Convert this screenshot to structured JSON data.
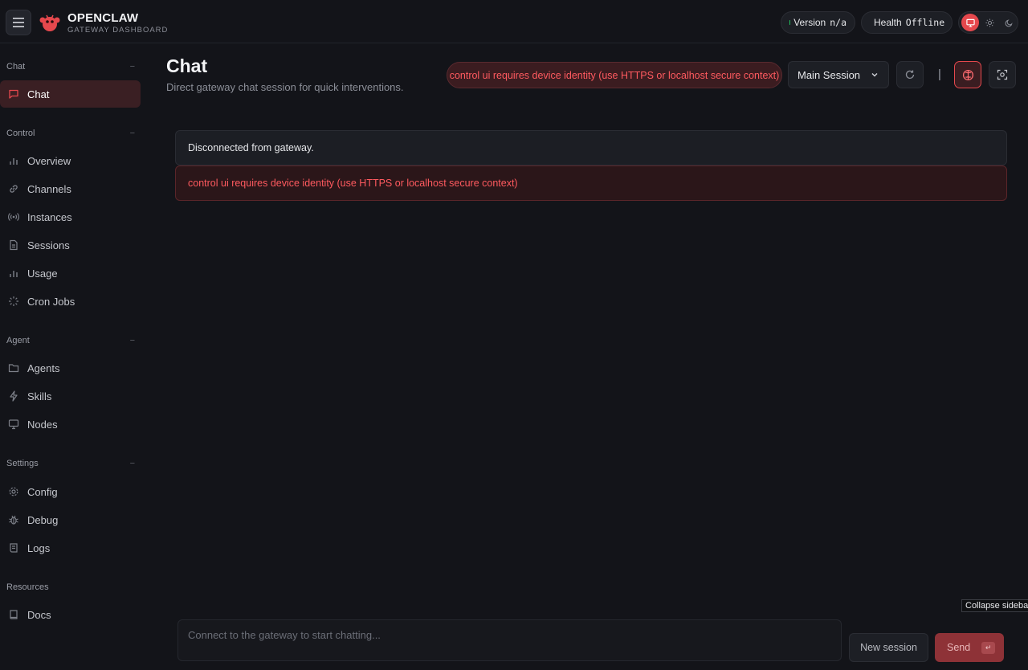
{
  "brand": {
    "title": "OPENCLAW",
    "subtitle": "GATEWAY DASHBOARD"
  },
  "status": {
    "version_label": "Version",
    "version_value": "n/a",
    "version_color": "#22c55e",
    "health_label": "Health",
    "health_value": "Offline",
    "health_color": "#ef4444"
  },
  "sidebar": {
    "sections": [
      {
        "label": "Chat",
        "items": [
          {
            "label": "Chat",
            "icon": "message-icon",
            "active": true
          }
        ]
      },
      {
        "label": "Control",
        "items": [
          {
            "label": "Overview",
            "icon": "bar-chart-icon"
          },
          {
            "label": "Channels",
            "icon": "link-icon"
          },
          {
            "label": "Instances",
            "icon": "broadcast-icon"
          },
          {
            "label": "Sessions",
            "icon": "document-icon"
          },
          {
            "label": "Usage",
            "icon": "bar-chart-icon"
          },
          {
            "label": "Cron Jobs",
            "icon": "loader-icon"
          }
        ]
      },
      {
        "label": "Agent",
        "items": [
          {
            "label": "Agents",
            "icon": "folder-icon"
          },
          {
            "label": "Skills",
            "icon": "lightning-icon"
          },
          {
            "label": "Nodes",
            "icon": "monitor-icon"
          }
        ]
      },
      {
        "label": "Settings",
        "items": [
          {
            "label": "Config",
            "icon": "gear-icon"
          },
          {
            "label": "Debug",
            "icon": "bug-icon"
          },
          {
            "label": "Logs",
            "icon": "scroll-icon"
          }
        ]
      },
      {
        "label": "Resources",
        "items": [
          {
            "label": "Docs",
            "icon": "book-icon"
          }
        ]
      }
    ]
  },
  "header": {
    "title": "Chat",
    "subtitle": "Direct gateway chat session for quick interventions.",
    "error": "control ui requires device identity (use HTTPS or localhost secure context)",
    "session_select": "Main Session",
    "separator": "|"
  },
  "messages": {
    "info": "Disconnected from gateway.",
    "error": "control ui requires device identity (use HTTPS or localhost secure context)"
  },
  "tooltip": "Collapse sidebar",
  "composer": {
    "placeholder": "Connect to the gateway to start chatting...",
    "new_session": "New session",
    "send": "Send",
    "send_key": "↵"
  },
  "colors": {
    "accent": "#e5484d",
    "background": "#131419"
  }
}
